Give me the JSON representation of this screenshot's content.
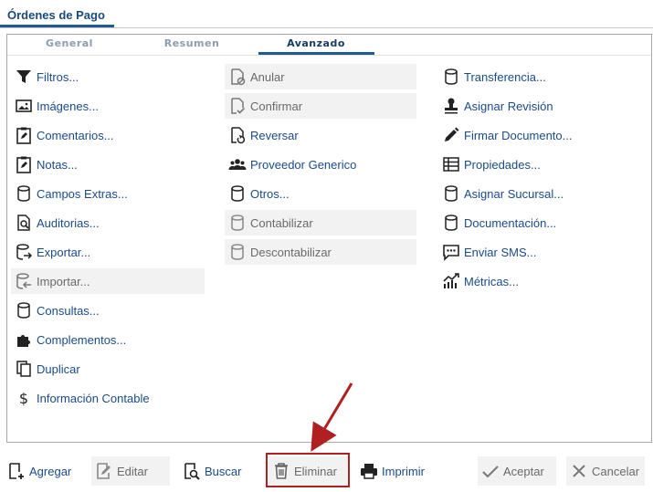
{
  "window": {
    "title": "Órdenes de Pago"
  },
  "tabs": [
    {
      "label": "General"
    },
    {
      "label": "Resumen"
    },
    {
      "label": "Avanzado"
    }
  ],
  "col1": [
    {
      "label": "Filtros...",
      "icon": "filter-icon"
    },
    {
      "label": "Imágenes...",
      "icon": "image-icon"
    },
    {
      "label": "Comentarios...",
      "icon": "clipboard-edit-icon"
    },
    {
      "label": "Notas...",
      "icon": "clipboard-edit-icon"
    },
    {
      "label": "Campos Extras...",
      "icon": "database-icon"
    },
    {
      "label": "Auditorias...",
      "icon": "document-search-icon"
    },
    {
      "label": "Exportar...",
      "icon": "database-export-icon"
    },
    {
      "label": "Importar...",
      "icon": "database-import-icon"
    },
    {
      "label": "Consultas...",
      "icon": "database-icon"
    },
    {
      "label": "Complementos...",
      "icon": "puzzle-icon"
    },
    {
      "label": "Duplicar",
      "icon": "copy-icon"
    },
    {
      "label": "Información Contable",
      "icon": "dollar-icon"
    }
  ],
  "col2": [
    {
      "label": "Anular",
      "icon": "document-cancel-icon"
    },
    {
      "label": "Confirmar",
      "icon": "document-check-icon"
    },
    {
      "label": "Reversar",
      "icon": "document-revert-icon"
    },
    {
      "label": "Proveedor Generico",
      "icon": "users-icon"
    },
    {
      "label": "Otros...",
      "icon": "database-icon"
    },
    {
      "label": "Contabilizar",
      "icon": "database-icon"
    },
    {
      "label": "Descontabilizar",
      "icon": "database-icon"
    }
  ],
  "col3": [
    {
      "label": "Transferencia...",
      "icon": "database-icon"
    },
    {
      "label": "Asignar Revisión",
      "icon": "stamp-icon"
    },
    {
      "label": "Firmar Documento...",
      "icon": "pen-icon"
    },
    {
      "label": "Propiedades...",
      "icon": "list-icon"
    },
    {
      "label": "Asignar Sucursal...",
      "icon": "database-icon"
    },
    {
      "label": "Documentación...",
      "icon": "database-icon"
    },
    {
      "label": "Enviar SMS...",
      "icon": "message-icon"
    },
    {
      "label": "Métricas...",
      "icon": "chart-icon"
    }
  ],
  "bottom": {
    "agregar": "Agregar",
    "editar": "Editar",
    "buscar": "Buscar",
    "eliminar": "Eliminar",
    "imprimir": "Imprimir",
    "aceptar": "Aceptar",
    "cancelar": "Cancelar"
  },
  "colors": {
    "link": "#1a4a8a",
    "disabled_text": "#6a6a6a",
    "highlight": "#b02020",
    "accent": "#1f5a96"
  }
}
